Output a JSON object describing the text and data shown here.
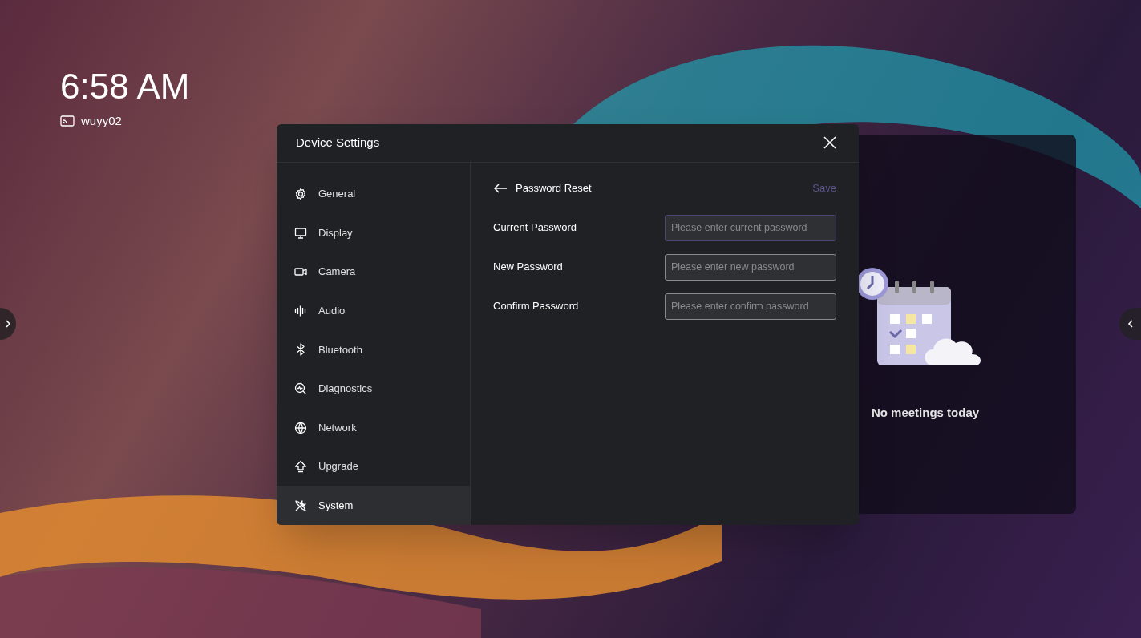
{
  "clock": {
    "time": "6:58 AM",
    "device_name": "wuyy02"
  },
  "meetings_panel": {
    "message": "No meetings today"
  },
  "dialog": {
    "title": "Device Settings",
    "sidebar": {
      "items": [
        {
          "label": "General",
          "selected": false
        },
        {
          "label": "Display",
          "selected": false
        },
        {
          "label": "Camera",
          "selected": false
        },
        {
          "label": "Audio",
          "selected": false
        },
        {
          "label": "Bluetooth",
          "selected": false
        },
        {
          "label": "Diagnostics",
          "selected": false
        },
        {
          "label": "Network",
          "selected": false
        },
        {
          "label": "Upgrade",
          "selected": false
        },
        {
          "label": "System",
          "selected": true
        }
      ]
    },
    "page": {
      "title": "Password Reset",
      "save": {
        "label": "Save",
        "disabled": true
      },
      "fields": [
        {
          "label": "Current Password",
          "placeholder": "Please enter current password",
          "focused": true
        },
        {
          "label": "New Password",
          "placeholder": "Please enter new password",
          "focused": false
        },
        {
          "label": "Confirm Password",
          "placeholder": "Please enter confirm password",
          "focused": false
        }
      ]
    }
  }
}
